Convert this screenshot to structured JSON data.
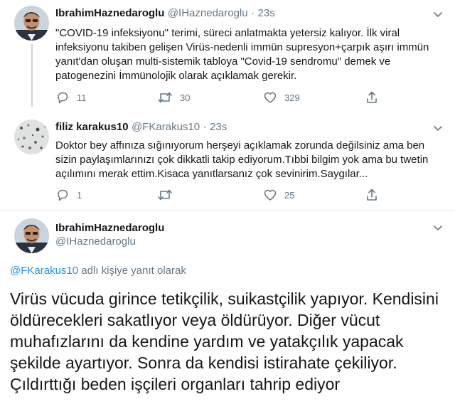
{
  "colors": {
    "accent": "#1b95e0",
    "text": "#14171a",
    "muted": "#657786",
    "line": "#ccd6dd"
  },
  "tweet1": {
    "display_name": "IbrahimHaznedaroglu",
    "handle": "@IHaznedaroglu",
    "dot": "·",
    "time": "23s",
    "text": "\"COVID-19 infeksiyonu\" terimi, süreci anlatmakta yetersiz kalıyor. İlk viral infeksiyonu takiben gelişen Virüs-nedenli immün supresyon+çarpık aşırı immün yanıt'dan oluşan multi-sistemik tabloya \"Covid-19 sendromu\" demek ve patogenezini İmmünolojik olarak açıklamak gerekir.",
    "replies": "11",
    "retweets": "30",
    "likes": "329"
  },
  "tweet2": {
    "display_name": "filiz karakus10",
    "handle": "@FKarakus10",
    "dot": "·",
    "time": "23s",
    "text": "Doktor bey affınıza sığınıyorum herşeyi açıklamak zorunda değilsiniz ama ben sizin paylaşımlarınızı çok dikkatli takip ediyorum.Tıbbi bilgim yok ama bu twetin açılımını merak ettim.Kisaca yanıtlarsanız çok sevinirim.Saygılar...",
    "replies": "1",
    "retweets": "",
    "likes": "25"
  },
  "tweet3": {
    "display_name": "IbrahimHaznedaroglu",
    "handle": "@IHaznedaroglu",
    "reply_mention": "@FKarakus10",
    "reply_suffix": " adlı kişiye yanıt olarak",
    "text": "Virüs vücuda girince tetikçilik, suikastçilik yapıyor. Kendisini öldürecekleri sakatlıyor veya öldürüyor. Diğer vücut muhafızlarını da kendine yardım ve yatakçılık yapacak şekilde ayartıyor. Sonra da kendisi istirahate çekiliyor. Çıldırttığı beden işçileri organları tahrip ediyor"
  }
}
